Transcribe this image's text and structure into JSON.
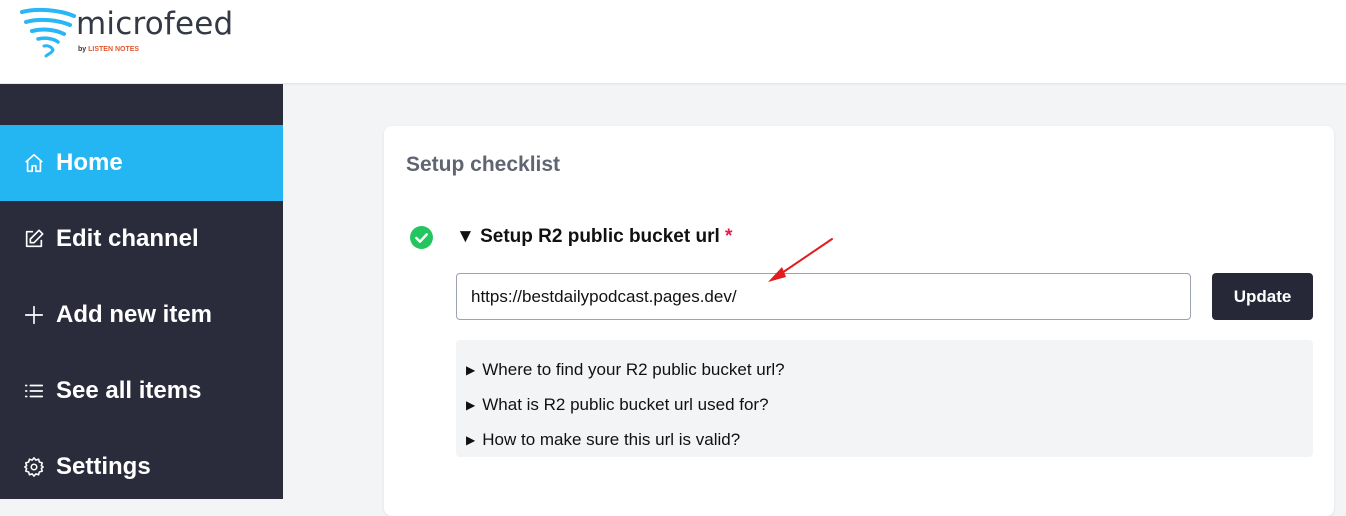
{
  "brand": {
    "name": "microfeed",
    "by": "by",
    "company": "LISTEN NOTES",
    "colors": {
      "mark": "#29b6f6",
      "accent": "#e4572e"
    }
  },
  "sidebar": {
    "items": [
      {
        "label": "Home",
        "icon": "home-icon",
        "active": true
      },
      {
        "label": "Edit channel",
        "icon": "edit-icon",
        "active": false
      },
      {
        "label": "Add new item",
        "icon": "plus-icon",
        "active": false
      },
      {
        "label": "See all items",
        "icon": "list-icon",
        "active": false
      },
      {
        "label": "Settings",
        "icon": "gear-icon",
        "active": false
      }
    ],
    "colors": {
      "background": "#2b2c3b",
      "active": "#23b6f2"
    }
  },
  "checklist": {
    "title": "Setup checklist",
    "item": {
      "triangle": "▼",
      "title": "Setup R2 public bucket url",
      "required_mark": "*",
      "status_icon": "check-circle-icon",
      "status_color": "#22c55e",
      "input_value": "https://bestdailypodcast.pages.dev/",
      "button_label": "Update",
      "faq": [
        {
          "triangle": "▶",
          "label": "Where to find your R2 public bucket url?"
        },
        {
          "triangle": "▶",
          "label": "What is R2 public bucket url used for?"
        },
        {
          "triangle": "▶",
          "label": "How to make sure this url is valid?"
        }
      ]
    }
  },
  "annotation": {
    "icon": "red-arrow-icon",
    "color": "#e11d1d"
  }
}
